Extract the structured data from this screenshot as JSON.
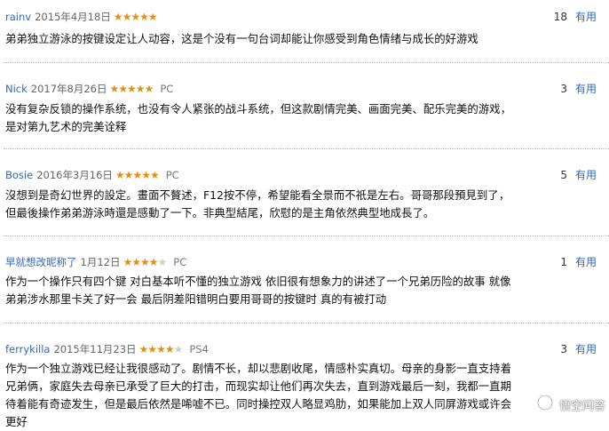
{
  "reviews": [
    {
      "user": "rainv",
      "date": "2015年4月18日",
      "rating": 5,
      "platform": "",
      "helpful_count": "18",
      "helpful_label": "有用",
      "text": "弟弟独立游泳的按键设定让人动容，这是个没有一句台词却能让你感受到角色情绪与成长的好游戏"
    },
    {
      "user": "Nick",
      "date": "2017年8月26日",
      "rating": 5,
      "platform": "PC",
      "helpful_count": "3",
      "helpful_label": "有用",
      "text": "没有复杂反锁的操作系统，也没有令人紧张的战斗系统，但这款剧情完美、画面完美、配乐完美的游戏，是对第九艺术的完美诠释"
    },
    {
      "user": "Bosie",
      "date": "2016年3月16日",
      "rating": 5,
      "platform": "PC",
      "helpful_count": "5",
      "helpful_label": "有用",
      "text": "沒想到是奇幻世界的設定。畫面不贅述，F12按不停，希望能看全景而不祇是左右。哥哥那段預見到了，但最後操作弟弟游泳時還是感動了一下。非典型結尾，欣慰的是主角依然典型地成長了。"
    },
    {
      "user": "早就想改昵称了",
      "date": "1月12日",
      "rating": 4,
      "platform": "PC",
      "helpful_count": "1",
      "helpful_label": "有用",
      "text": "作为一个操作只有四个键 对白基本听不懂的独立游戏 依旧很有想象力的讲述了一个兄弟历险的故事 就像弟弟涉水那里卡关了好一会 最后阴差阳错明白要用哥哥的按键时 真的有被打动"
    },
    {
      "user": "ferrykilla",
      "date": "2015年11月23日",
      "rating": 4,
      "platform": "PS4",
      "helpful_count": "3",
      "helpful_label": "有用",
      "text": "作为一个独立游戏已经让我很感动了。剧情不长，却以悲剧收尾，情感朴实真切。母亲的身影一直支持着兄弟俩，家庭失去母亲已承受了巨大的打击，而现实却让他们再次失去，直到游戏最后一刻，我都一直期待着能有奇迹发生，但是最后依然是唏嘘不已。同时操控双人略显鸡肋，如果能加上双人同屏游戏或许会更好"
    }
  ],
  "watermark": {
    "text": "悟空问答",
    "icon": "wukong-logo-icon"
  },
  "colors": {
    "link": "#3366bb",
    "star_on": "#e09015",
    "star_off": "#cfcfcf",
    "divider": "#b8b8b8"
  }
}
